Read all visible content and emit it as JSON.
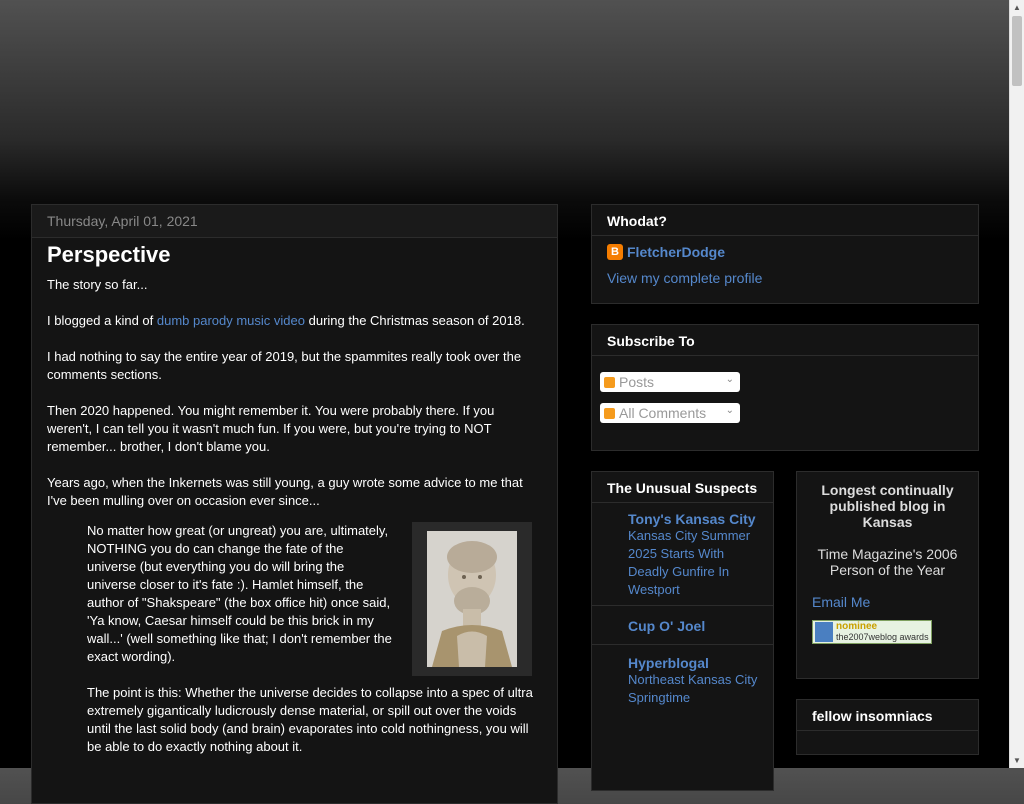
{
  "post": {
    "date": "Thursday, April 01, 2021",
    "title": "Perspective",
    "paragraphs": [
      {
        "text": "The story so far..."
      },
      {
        "before": "I blogged a kind of ",
        "link": "dumb parody music video",
        "after": " during the Christmas season of 2018."
      },
      {
        "text": "I had nothing to say the entire year of 2019, but the spammites really took over the comments sections."
      },
      {
        "text": "Then 2020 happened. You might remember it. You were probably there. If you weren't, I can tell you it wasn't much fun. If you were, but you're trying to NOT remember... brother, I don't blame you."
      },
      {
        "text": "Years ago, when the Inkernets was still young, a guy wrote some advice to me that I've been mulling over on occasion ever since..."
      }
    ],
    "quote": [
      "No matter how great (or ungreat) you are, ultimately, NOTHING you do can change the fate of the universe (but everything you do will bring the universe closer to it's fate :). Hamlet himself, the author of \"Shakspeare\" (the box office hit) once said, 'Ya know, Caesar himself could be this brick in my wall...' (well something like that; I don't remember the exact wording).",
      "The point is this: Whether the universe decides to collapse into a spec of ultra extremely gigantically ludicrously dense material, or spill out over the voids until the last solid body (and brain) evaporates into cold nothingness, you will be able to do exactly nothing about it."
    ],
    "image_icon": "aristotle-bust-image"
  },
  "sidebar": {
    "whodat": {
      "title": "Whodat?",
      "name": "FletcherDodge",
      "profile_link": "View my complete profile",
      "icon": "blogger-icon"
    },
    "subscribe": {
      "title": "Subscribe To",
      "items": [
        "Posts",
        "All Comments"
      ]
    },
    "suspects": {
      "title": "The Unusual Suspects",
      "blogs": [
        {
          "name": "Tony's Kansas City",
          "post": "Kansas City Summer 2025 Starts With Deadly Gunfire In Westport"
        },
        {
          "name": "Cup O' Joel",
          "post": ""
        },
        {
          "name": "Hyperblogal",
          "post": "Northeast Kansas City Springtime"
        }
      ]
    },
    "longest": {
      "title": "Longest continually published blog in Kansas",
      "text": "Time Magazine's 2006 Person of the Year",
      "email": "Email Me",
      "badge_top": "nominee",
      "badge_bottom": "the2007weblog awards"
    },
    "insomniacs": {
      "title": "fellow insomniacs"
    }
  },
  "colors": {
    "link": "#5588cc",
    "panel": "#141414",
    "border": "#2c2c2c"
  }
}
